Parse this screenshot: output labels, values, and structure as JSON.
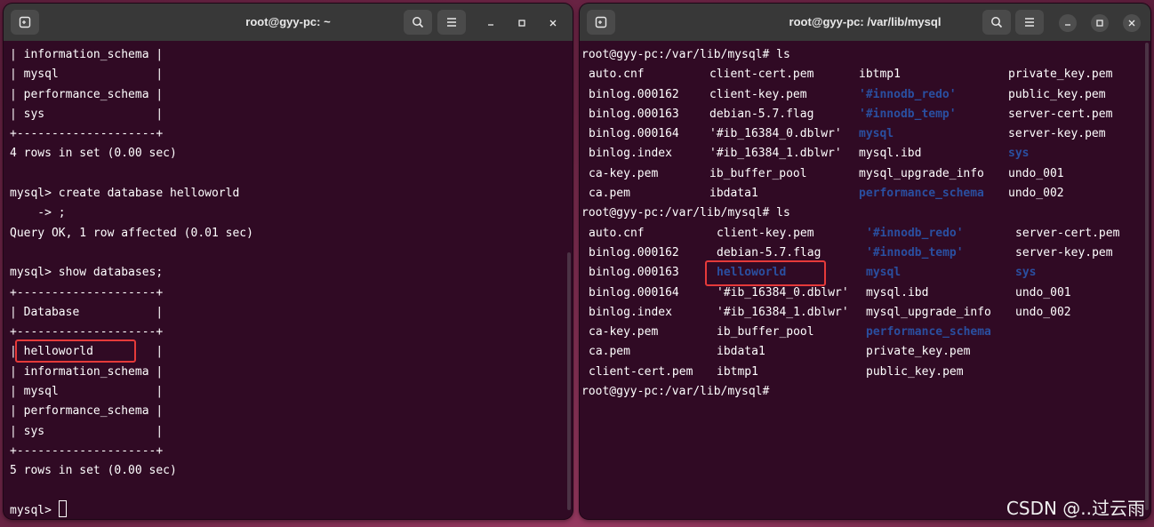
{
  "left": {
    "title": "root@gyy-pc: ~",
    "lines": [
      "| information_schema |",
      "| mysql              |",
      "| performance_schema |",
      "| sys                |",
      "+--------------------+",
      "4 rows in set (0.00 sec)",
      "",
      "mysql> create database helloworld",
      "    -> ;",
      "Query OK, 1 row affected (0.01 sec)",
      "",
      "mysql> show databases;",
      "+--------------------+",
      "| Database           |",
      "+--------------------+",
      "| helloworld         |",
      "| information_schema |",
      "| mysql              |",
      "| performance_schema |",
      "| sys                |",
      "+--------------------+",
      "5 rows in set (0.00 sec)",
      ""
    ],
    "prompt": "mysql> "
  },
  "right": {
    "title": "root@gyy-pc: /var/lib/mysql",
    "prompt1": "root@gyy-pc:/var/lib/mysql# ls",
    "ls1": [
      [
        "auto.cnf",
        "client-cert.pem",
        "ibtmp1",
        "private_key.pem"
      ],
      [
        "binlog.000162",
        "client-key.pem",
        "'#innodb_redo'",
        "public_key.pem"
      ],
      [
        "binlog.000163",
        "debian-5.7.flag",
        "'#innodb_temp'",
        "server-cert.pem"
      ],
      [
        "binlog.000164",
        "'#ib_16384_0.dblwr'",
        "mysql",
        "server-key.pem"
      ],
      [
        "binlog.index",
        "'#ib_16384_1.dblwr'",
        "mysql.ibd",
        "sys"
      ],
      [
        "ca-key.pem",
        "ib_buffer_pool",
        "mysql_upgrade_info",
        "undo_001"
      ],
      [
        "ca.pem",
        "ibdata1",
        "performance_schema",
        "undo_002"
      ]
    ],
    "prompt2": "root@gyy-pc:/var/lib/mysql# ls",
    "ls2": [
      [
        "auto.cnf",
        "client-key.pem",
        "'#innodb_redo'",
        "server-cert.pem"
      ],
      [
        "binlog.000162",
        "debian-5.7.flag",
        "'#innodb_temp'",
        "server-key.pem"
      ],
      [
        "binlog.000163",
        "helloworld",
        "mysql",
        "sys"
      ],
      [
        "binlog.000164",
        "'#ib_16384_0.dblwr'",
        "mysql.ibd",
        "undo_001"
      ],
      [
        "binlog.index",
        "'#ib_16384_1.dblwr'",
        "mysql_upgrade_info",
        "undo_002"
      ],
      [
        "ca-key.pem",
        "ib_buffer_pool",
        "performance_schema",
        ""
      ],
      [
        "ca.pem",
        "ibdata1",
        "private_key.pem",
        ""
      ],
      [
        "client-cert.pem",
        "ibtmp1",
        "public_key.pem",
        ""
      ]
    ],
    "prompt3": "root@gyy-pc:/var/lib/mysql#"
  },
  "dirs": [
    "'#innodb_redo'",
    "'#innodb_temp'",
    "mysql",
    "sys",
    "performance_schema",
    "helloworld"
  ],
  "colors": {
    "terminal_bg": "#300a24",
    "titlebar_bg": "#383838",
    "directory": "#2a4fa0",
    "highlight_box": "#e53a3a"
  },
  "watermark": "CSDN @..过云雨"
}
